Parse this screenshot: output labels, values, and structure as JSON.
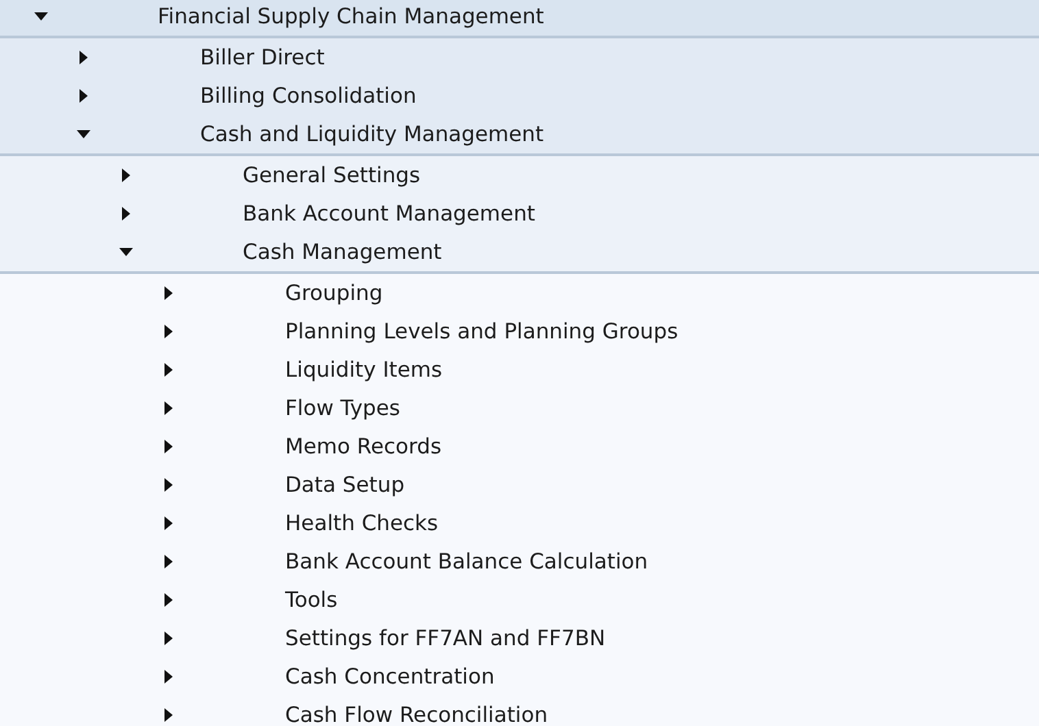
{
  "tree": [
    {
      "label": "Financial Supply Chain Management",
      "expanded": true,
      "children": [
        {
          "label": "Biller Direct",
          "expanded": false
        },
        {
          "label": "Billing Consolidation",
          "expanded": false
        },
        {
          "label": "Cash and Liquidity Management",
          "expanded": true,
          "children": [
            {
              "label": "General Settings",
              "expanded": false
            },
            {
              "label": "Bank Account Management",
              "expanded": false
            },
            {
              "label": "Cash Management",
              "expanded": true,
              "children": [
                {
                  "label": "Grouping",
                  "expanded": false
                },
                {
                  "label": "Planning Levels and Planning Groups",
                  "expanded": false
                },
                {
                  "label": "Liquidity Items",
                  "expanded": false
                },
                {
                  "label": "Flow Types",
                  "expanded": false
                },
                {
                  "label": "Memo Records",
                  "expanded": false
                },
                {
                  "label": "Data Setup",
                  "expanded": false
                },
                {
                  "label": "Health Checks",
                  "expanded": false
                },
                {
                  "label": "Bank Account Balance Calculation",
                  "expanded": false
                },
                {
                  "label": "Tools",
                  "expanded": false
                },
                {
                  "label": "Settings for FF7AN and FF7BN",
                  "expanded": false
                },
                {
                  "label": "Cash Concentration",
                  "expanded": false
                },
                {
                  "label": "Cash Flow Reconciliation",
                  "expanded": false
                }
              ]
            }
          ]
        }
      ]
    }
  ]
}
